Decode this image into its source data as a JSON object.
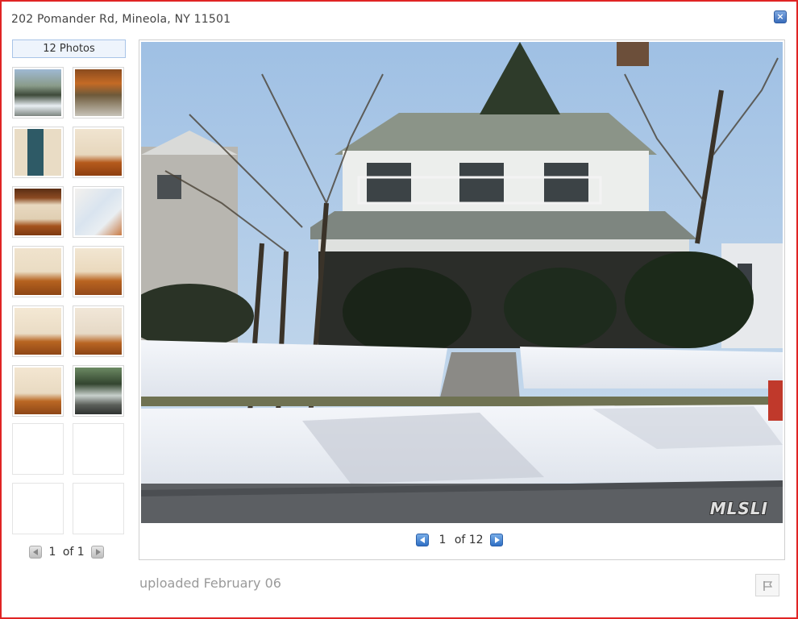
{
  "window": {
    "title": "202 Pomander Rd, Mineola, NY 11501",
    "close_icon": "close-icon"
  },
  "gallery": {
    "photo_count_label": "12 Photos",
    "thumbnail_pager": {
      "current": "1",
      "separator": "of 1"
    },
    "main_pager": {
      "current": "1",
      "separator": "of 12"
    },
    "uploaded_label": "uploaded February 06",
    "watermark": "MLSLI"
  },
  "colors": {
    "frame_border": "#e02424",
    "accent_blue": "#2f6fc4"
  }
}
